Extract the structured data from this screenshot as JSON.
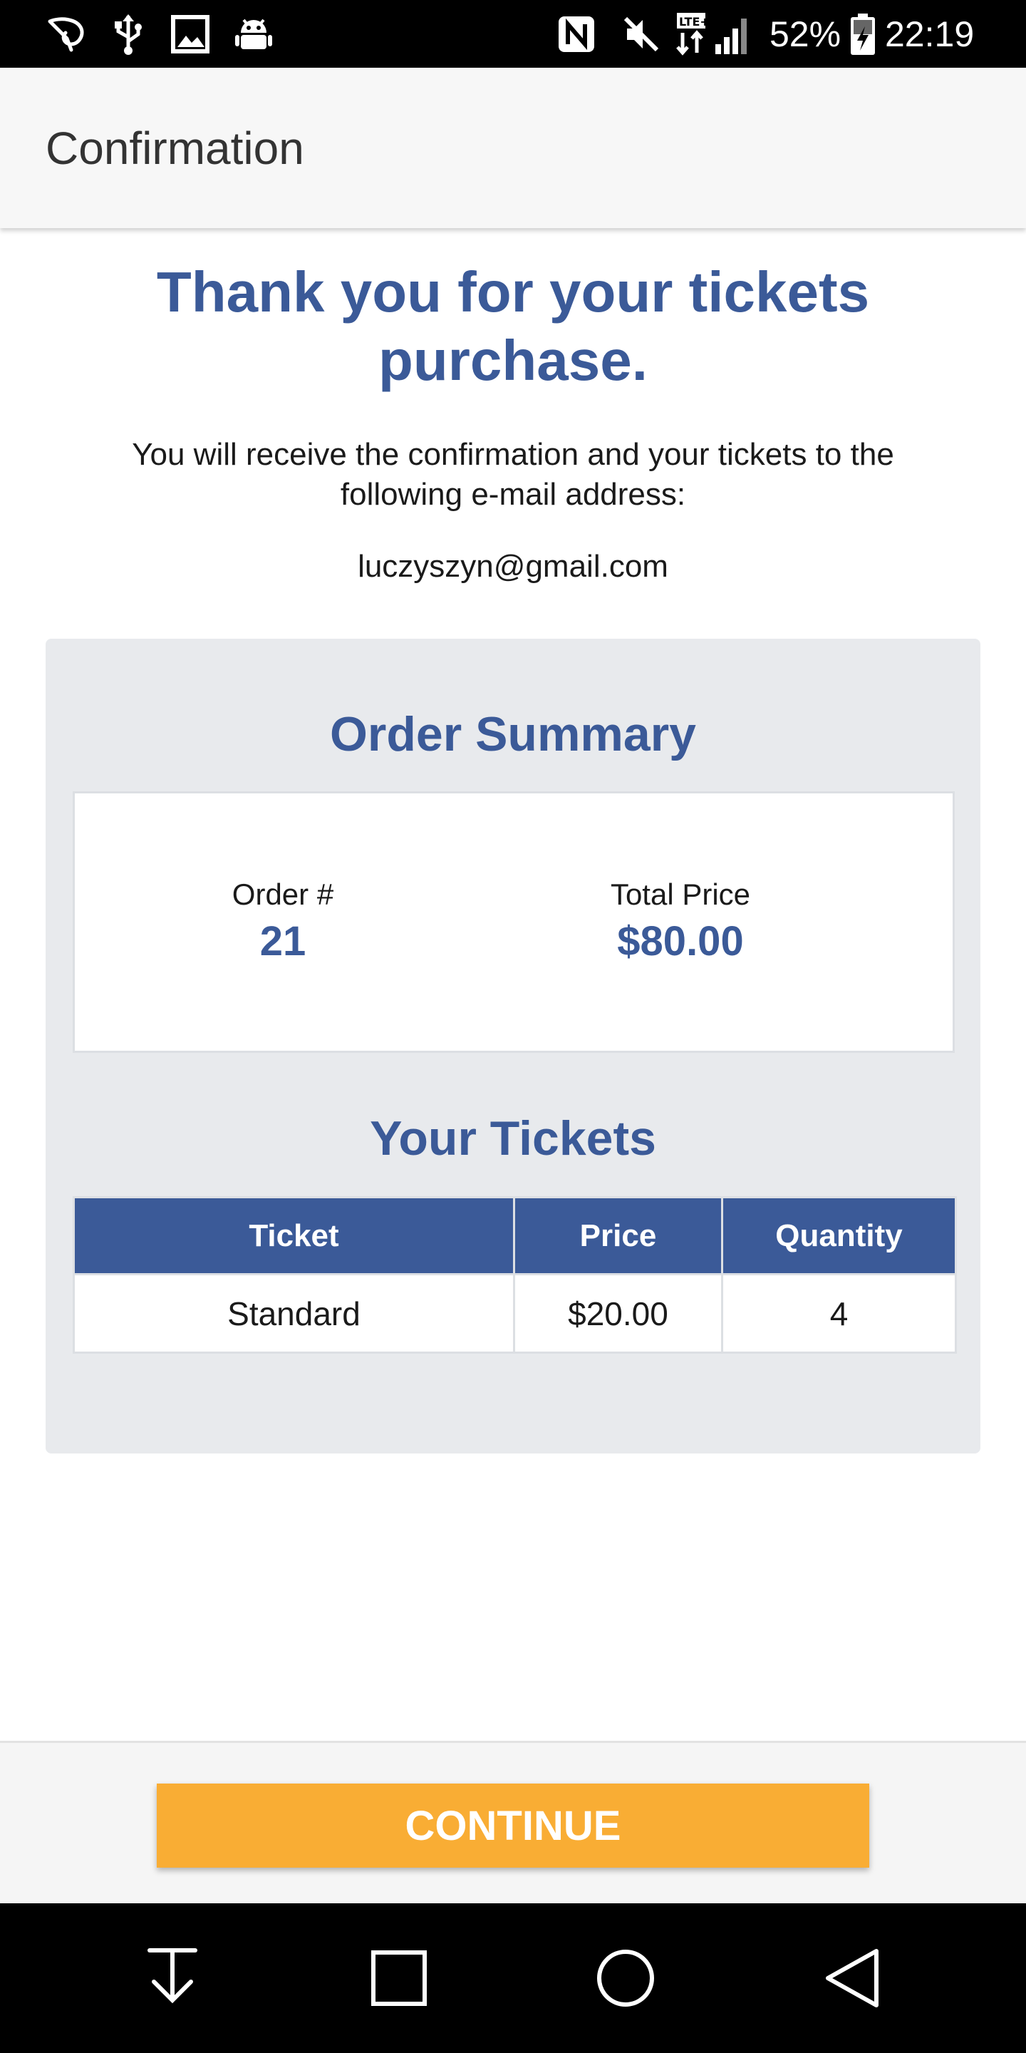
{
  "status_bar": {
    "battery": "52%",
    "time": "22:19",
    "icons": [
      "leaf-outline-icon",
      "usb-icon",
      "image-icon",
      "android-icon",
      "nfc-icon",
      "mute-icon",
      "lte-icon",
      "signal-icon",
      "battery-charging-icon"
    ]
  },
  "app_bar": {
    "title": "Confirmation"
  },
  "content": {
    "heading": "Thank you for your tickets purchase.",
    "message": "You will receive the confirmation and your tickets to the following e-mail address:",
    "email": "luczyszyn@gmail.com"
  },
  "order_summary": {
    "title": "Order Summary",
    "order_label": "Order #",
    "order_number": "21",
    "total_label": "Total Price",
    "total_value": "$80.00"
  },
  "tickets": {
    "title": "Your Tickets",
    "columns": [
      "Ticket",
      "Price",
      "Quantity"
    ],
    "rows": [
      [
        "Standard",
        "$20.00",
        "4"
      ]
    ]
  },
  "actions": {
    "continue_label": "CONTINUE"
  },
  "colors": {
    "accent_blue": "#3b5a98",
    "button_orange": "#f9ad34",
    "panel_gray": "#e8eaed"
  },
  "nav_bar": {
    "icons": [
      "download-arrow-icon",
      "recents-square-icon",
      "home-circle-icon",
      "back-triangle-icon"
    ]
  }
}
